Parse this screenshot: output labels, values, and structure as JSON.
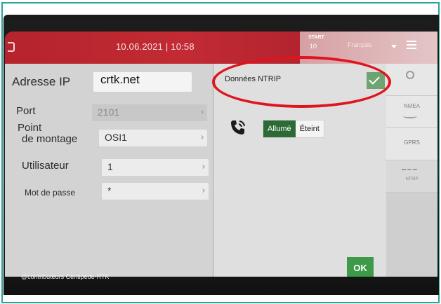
{
  "header": {
    "datetime": "10.06.2021 | 10:58",
    "start_label": "START",
    "start_sub": "10",
    "language": "Français"
  },
  "form": {
    "ip_label": "Adresse IP",
    "ip_value": "crtk.net",
    "port_label": "Port",
    "port_value": "2101",
    "mount_label_line1": "Point",
    "mount_label_line2": "de montage",
    "mount_value": "OSI1",
    "user_label": "Utilisateur",
    "user_value": "1",
    "password_label": "Mot de passe",
    "password_value": "*"
  },
  "ntrip": {
    "label": "Données NTRIP",
    "toggle_on": "Allumé",
    "toggle_off": "Éteint",
    "ok_label": "OK"
  },
  "tabs": {
    "nmea": "NMEA",
    "gprs": "GPRS",
    "ntrip": "NTRIP"
  },
  "credit": "@contributeurs Centipede-RTK",
  "colors": {
    "title_red": "#c22b33",
    "frame_teal": "#2aa39a",
    "ok_green": "#3d9a48",
    "toggle_green": "#2c6b36",
    "highlight_red": "#e0141e"
  }
}
